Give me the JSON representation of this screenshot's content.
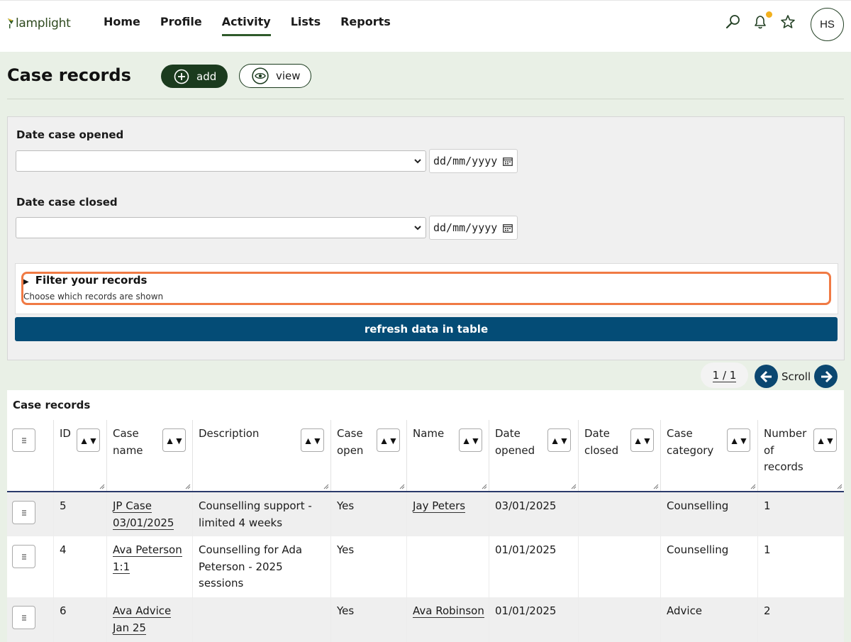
{
  "brand": {
    "name": "lamplight"
  },
  "nav": {
    "items": [
      {
        "label": "Home"
      },
      {
        "label": "Profile"
      },
      {
        "label": "Activity",
        "active": true
      },
      {
        "label": "Lists"
      },
      {
        "label": "Reports"
      }
    ]
  },
  "header_icons": [
    "search-icon",
    "bell-icon",
    "star-icon"
  ],
  "user": {
    "initials": "HS"
  },
  "page": {
    "title": "Case records",
    "add_label": "add",
    "view_label": "view"
  },
  "filters": {
    "date_opened_label": "Date case opened",
    "date_closed_label": "Date case closed",
    "date_placeholder": "dd/mm/yyyy",
    "filter_title": "Filter your records",
    "filter_subtitle": "Choose which records are shown",
    "refresh_label": "refresh data in table"
  },
  "pager": {
    "page": "1 / 1",
    "scroll_label": "Scroll"
  },
  "table": {
    "caption": "Case records",
    "columns": [
      "ID",
      "Case name",
      "Description",
      "Case open",
      "Name",
      "Date opened",
      "Date closed",
      "Case category",
      "Number of records"
    ],
    "rows": [
      {
        "id": "5",
        "case_name": "JP Case 03/01/2025",
        "description": "Counselling support - limited 4 weeks",
        "case_open": "Yes",
        "name": "Jay Peters",
        "date_opened": "03/01/2025",
        "date_closed": "",
        "category": "Counselling",
        "records": "1"
      },
      {
        "id": "4",
        "case_name": "Ava Peterson 1:1",
        "description": "Counselling for Ada Peterson - 2025 sessions",
        "case_open": "Yes",
        "name": "",
        "date_opened": "01/01/2025",
        "date_closed": "",
        "category": "Counselling",
        "records": "1"
      },
      {
        "id": "6",
        "case_name": "Ava Advice Jan 25",
        "description": "",
        "case_open": "Yes",
        "name": "Ava Robinson",
        "date_opened": "01/01/2025",
        "date_closed": "",
        "category": "Advice",
        "records": "2"
      }
    ]
  },
  "colors": {
    "accent_dark_green": "#1b3b1e",
    "primary_blue": "#044c76",
    "highlight_orange": "#f07a44",
    "page_bg": "#e9f0e6",
    "notification": "#f2b01e"
  }
}
